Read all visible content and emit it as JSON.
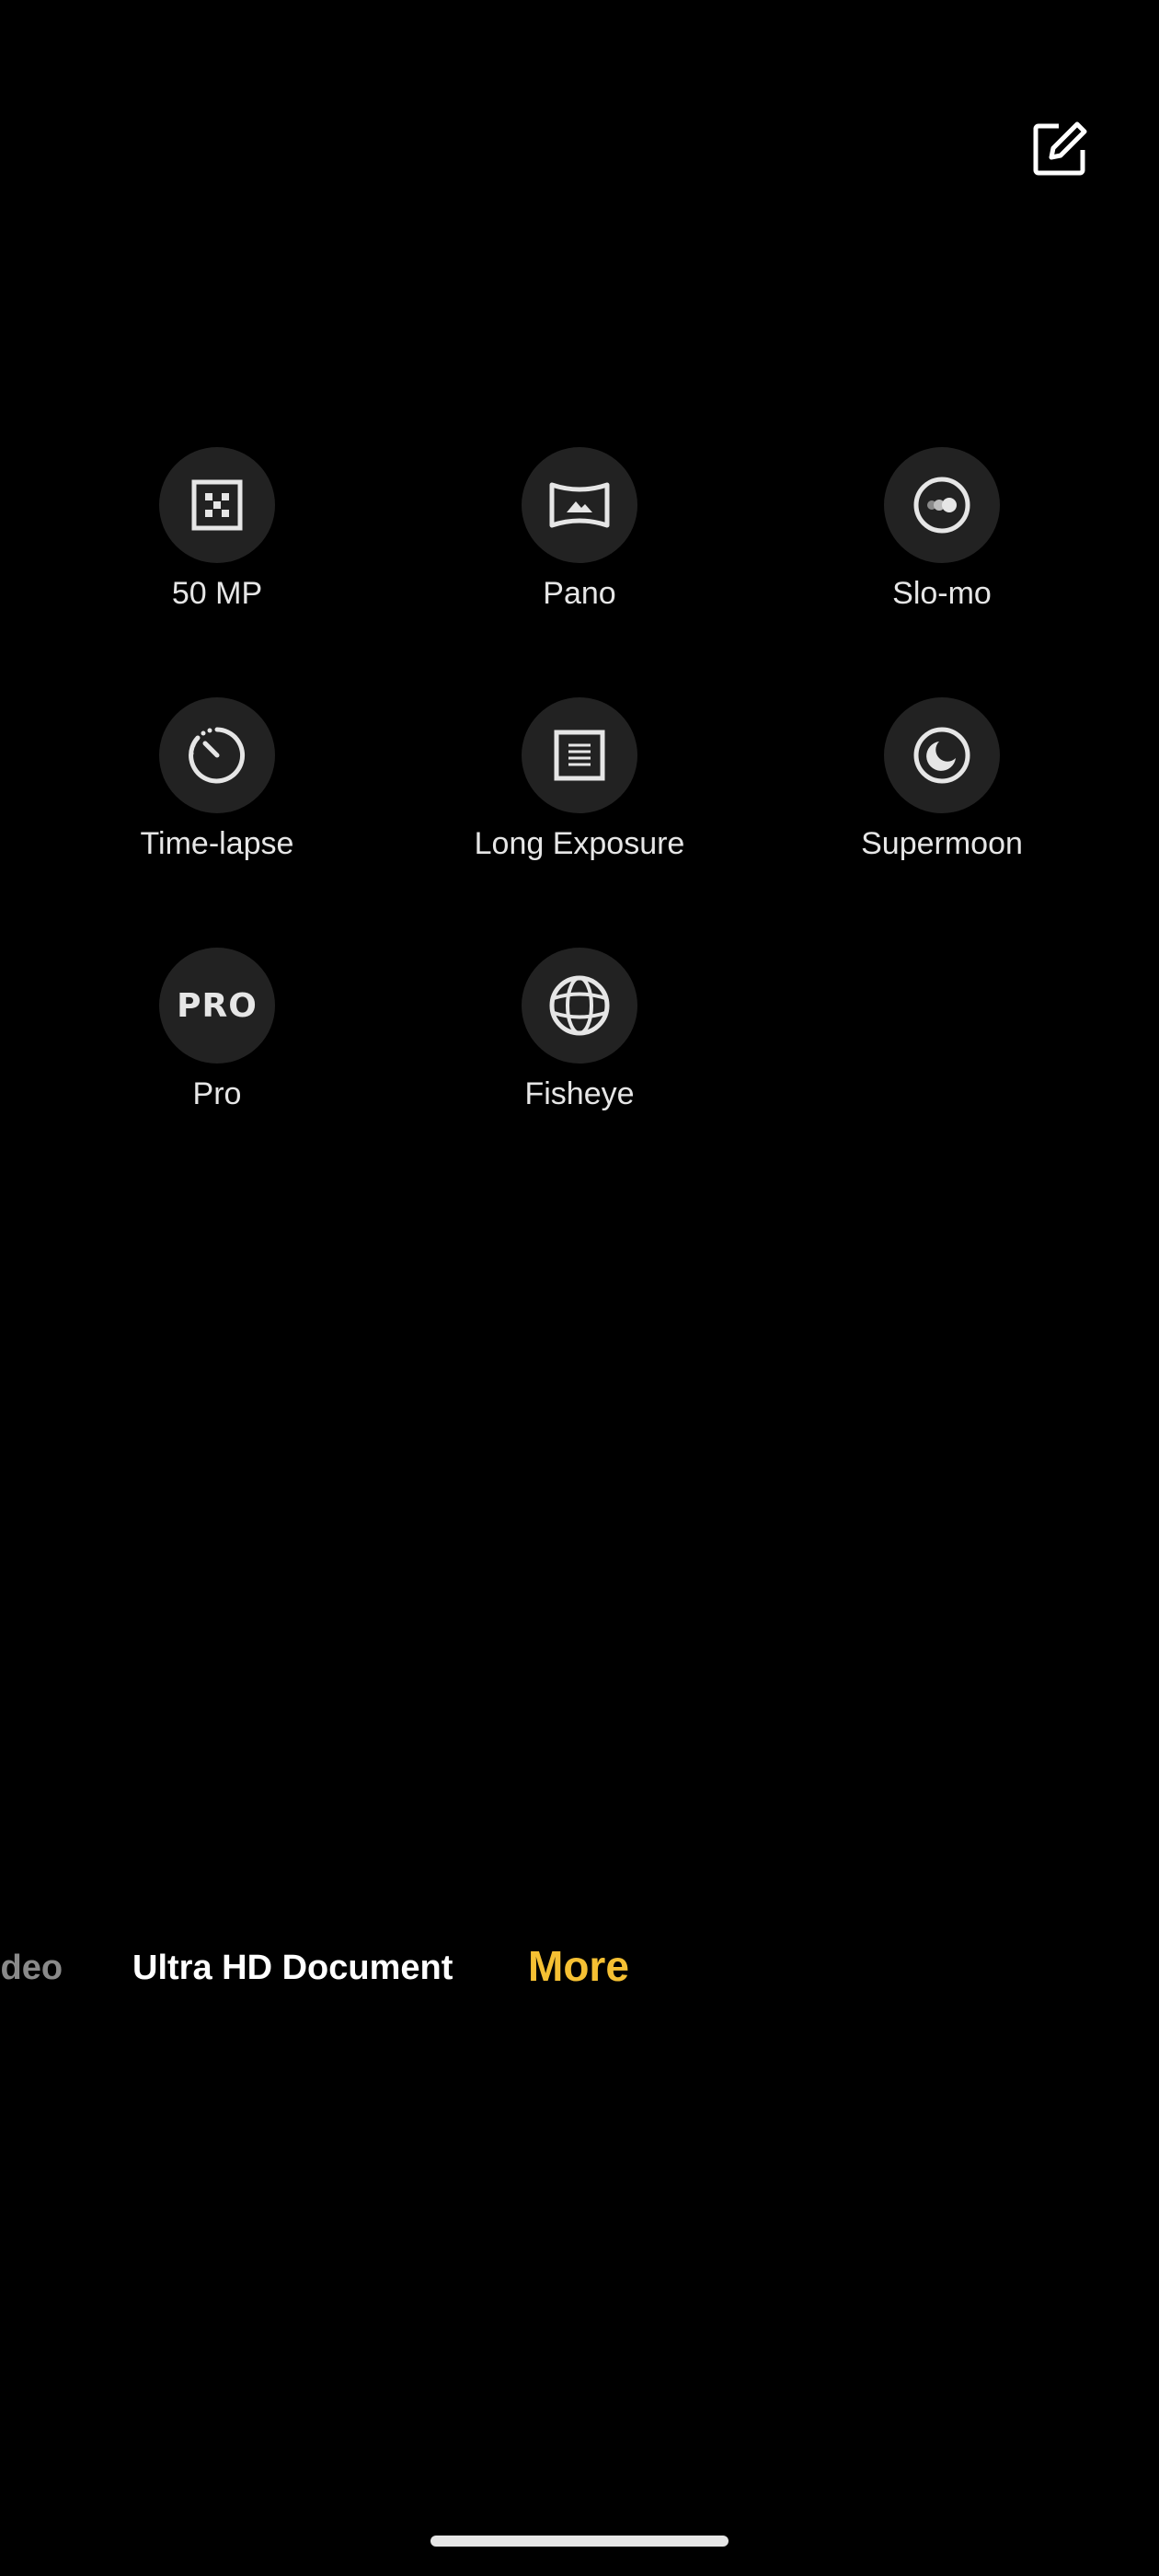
{
  "top_bar": {
    "edit_icon": "edit-icon"
  },
  "modes": [
    {
      "label": "50 MP",
      "icon": "grid-dots-icon"
    },
    {
      "label": "Pano",
      "icon": "panorama-icon"
    },
    {
      "label": "Slo-mo",
      "icon": "slow-motion-icon"
    },
    {
      "label": "Time-lapse",
      "icon": "timer-icon"
    },
    {
      "label": "Long Exposure",
      "icon": "long-exposure-icon"
    },
    {
      "label": "Supermoon",
      "icon": "moon-icon"
    },
    {
      "label": "Pro",
      "icon": "pro-icon",
      "icon_text": "PRO"
    },
    {
      "label": "Fisheye",
      "icon": "globe-icon"
    }
  ],
  "mode_bar": {
    "items": [
      "ideo",
      "Ultra HD Document",
      "More"
    ],
    "active": "More",
    "active_color": "#f5c033"
  }
}
